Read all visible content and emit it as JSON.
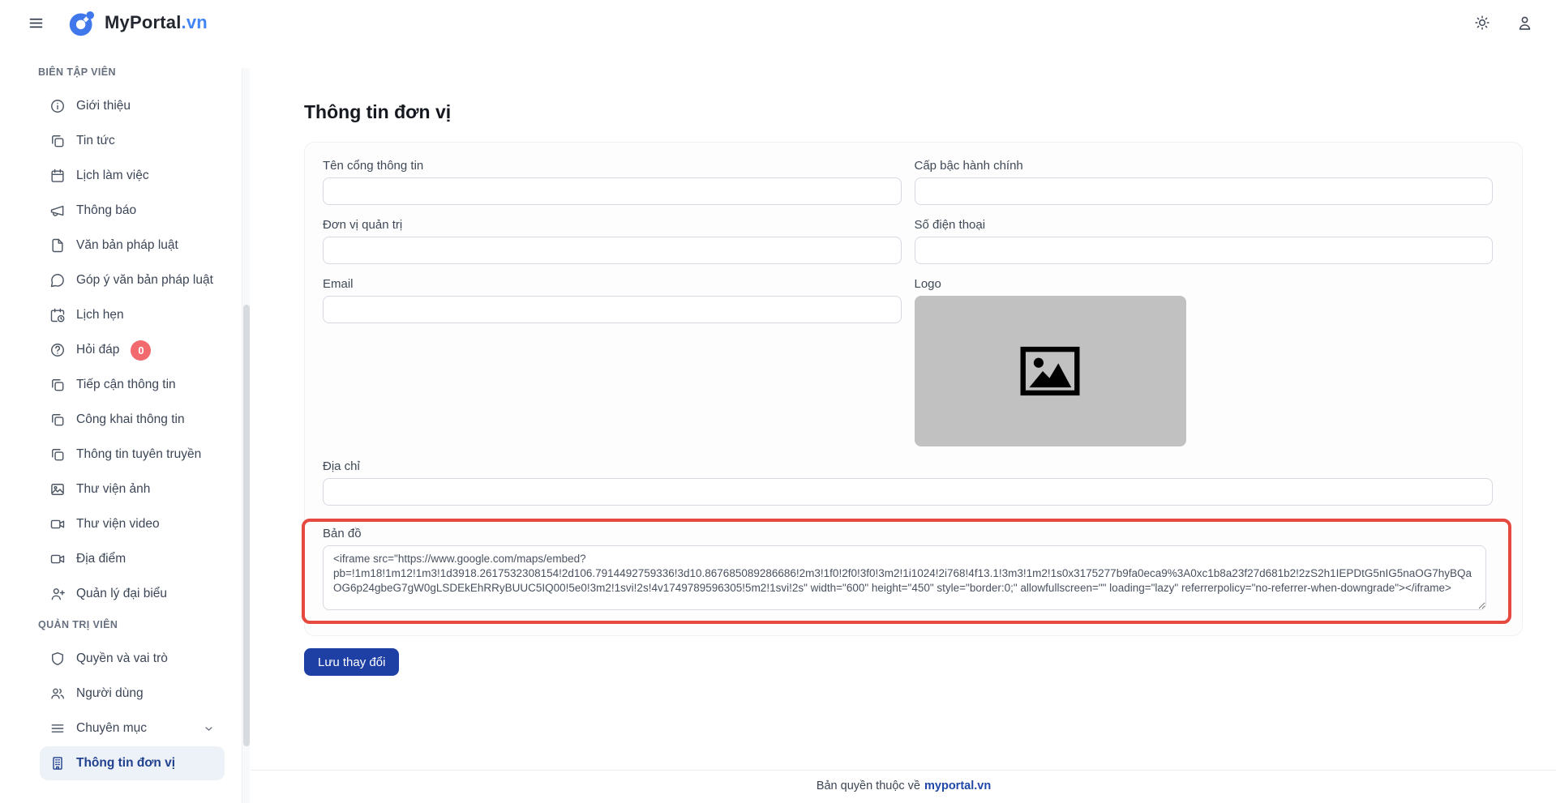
{
  "header": {
    "brand_name": "MyPortal",
    "brand_tld": ".vn",
    "icons": [
      "hamburger-menu-icon",
      "portal-logo-icon",
      "sun-icon",
      "user-icon"
    ]
  },
  "sidebar": {
    "sections": [
      {
        "label": "BIÊN TẬP VIÊN",
        "items": [
          {
            "label": "Giới thiệu",
            "icon": "info"
          },
          {
            "label": "Tin tức",
            "icon": "copy"
          },
          {
            "label": "Lịch làm việc",
            "icon": "calendar"
          },
          {
            "label": "Thông báo",
            "icon": "megaphone"
          },
          {
            "label": "Văn bản pháp luật",
            "icon": "file"
          },
          {
            "label": "Góp ý văn bản pháp luật",
            "icon": "chat"
          },
          {
            "label": "Lịch hẹn",
            "icon": "calendar-clock"
          },
          {
            "label": "Hỏi đáp",
            "icon": "help",
            "badge": "0"
          },
          {
            "label": "Tiếp cận thông tin",
            "icon": "copy"
          },
          {
            "label": "Công khai thông tin",
            "icon": "copy"
          },
          {
            "label": "Thông tin tuyên truyền",
            "icon": "copy"
          },
          {
            "label": "Thư viện ảnh",
            "icon": "image"
          },
          {
            "label": "Thư viện video",
            "icon": "video"
          },
          {
            "label": "Địa điểm",
            "icon": "video"
          },
          {
            "label": "Quản lý đại biểu",
            "icon": "user-plus"
          }
        ]
      },
      {
        "label": "QUẢN TRỊ VIÊN",
        "items": [
          {
            "label": "Quyền và vai trò",
            "icon": "shield"
          },
          {
            "label": "Người dùng",
            "icon": "users"
          },
          {
            "label": "Chuyên mục",
            "icon": "list",
            "chevron": true
          },
          {
            "label": "Thông tin đơn vị",
            "icon": "building",
            "active": true
          }
        ]
      }
    ]
  },
  "main": {
    "title": "Thông tin đơn vị",
    "form": {
      "portal_name": {
        "label": "Tên cổng thông tin",
        "value": ""
      },
      "admin_level": {
        "label": "Cấp bậc hành chính",
        "value": ""
      },
      "managing_unit": {
        "label": "Đơn vị quản trị",
        "value": ""
      },
      "phone": {
        "label": "Số điện thoại",
        "value": ""
      },
      "email": {
        "label": "Email",
        "value": ""
      },
      "logo": {
        "label": "Logo",
        "placeholder_icon": "image-placeholder-icon"
      },
      "address": {
        "label": "Địa chỉ",
        "value": ""
      },
      "map": {
        "label": "Bản đồ",
        "value": "<iframe src=\"https://www.google.com/maps/embed?pb=!1m18!1m12!1m3!1d3918.2617532308154!2d106.7914492759336!3d10.867685089286686!2m3!1f0!2f0!3f0!3m2!1i1024!2i768!4f13.1!3m3!1m2!1s0x3175277b9fa0eca9%3A0xc1b8a23f27d681b2!2zS2h1IEPDtG5nIG5naOG7hyBQaOG6p24gbeG7gW0gLSDEkEhRRyBUUC5IQ00!5e0!3m2!1svi!2s!4v1749789596305!5m2!1svi!2s\" width=\"600\" height=\"450\" style=\"border:0;\" allowfullscreen=\"\" loading=\"lazy\" referrerpolicy=\"no-referrer-when-downgrade\"></iframe>",
        "highlighted": true
      }
    },
    "save_label": "Lưu thay đổi"
  },
  "footer": {
    "text": "Bản quyền thuộc về",
    "link": "myportal.vn"
  },
  "colors": {
    "brand_blue": "#4285f4",
    "active_text": "#21418f",
    "active_bg": "#edf1f8",
    "badge_red": "#f2696e",
    "highlight_red": "#e5493f",
    "button_blue": "#1e40a5",
    "logo_placeholder_gray": "#c1c1c1"
  }
}
